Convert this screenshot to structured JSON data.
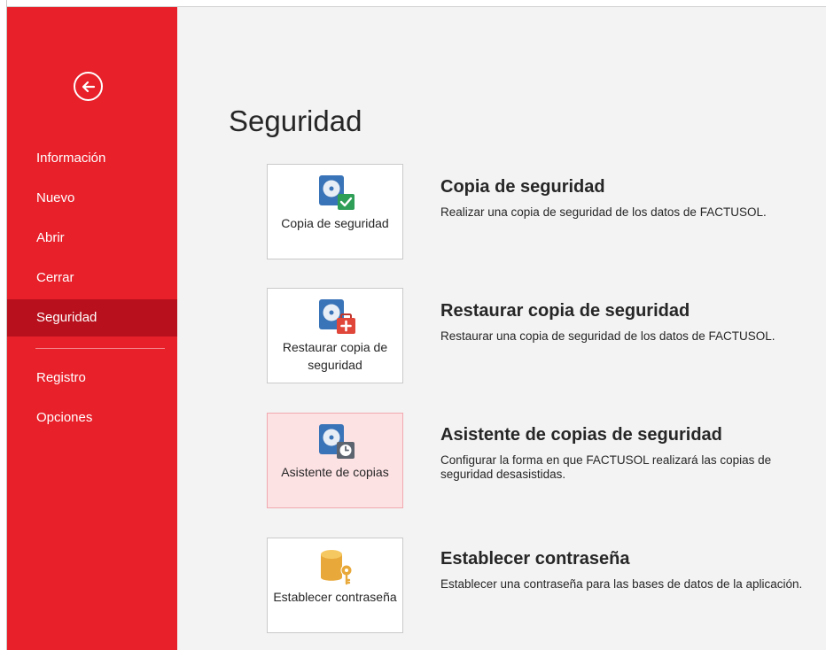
{
  "sidebar": {
    "items": [
      {
        "label": "Información"
      },
      {
        "label": "Nuevo"
      },
      {
        "label": "Abrir"
      },
      {
        "label": "Cerrar"
      },
      {
        "label": "Seguridad",
        "active": true
      },
      {
        "label": "Registro"
      },
      {
        "label": "Opciones"
      }
    ]
  },
  "main": {
    "title": "Seguridad",
    "actions": [
      {
        "card_label": "Copia de seguridad",
        "icon": "backup-disk-check-icon",
        "title": "Copia de seguridad",
        "description": "Realizar una copia de seguridad de los datos de FACTUSOL."
      },
      {
        "card_label": "Restaurar copia de seguridad",
        "icon": "restore-disk-medkit-icon",
        "title": "Restaurar copia de seguridad",
        "description": "Restaurar una copia de seguridad de los datos de FACTUSOL."
      },
      {
        "card_label": "Asistente de copias",
        "icon": "backup-wizard-clock-icon",
        "title": "Asistente de copias de seguridad",
        "description": "Configurar la forma en que FACTUSOL realizará las copias de seguridad desasistidas.",
        "hovered": true
      },
      {
        "card_label": "Establecer contraseña",
        "icon": "database-key-icon",
        "title": "Establecer contraseña",
        "description": "Establecer una contraseña para las bases de datos de la aplicación."
      }
    ]
  },
  "colors": {
    "sidebar": "#e8202a",
    "sidebar_active": "#b8101c",
    "card_hover": "#fde2e4"
  }
}
